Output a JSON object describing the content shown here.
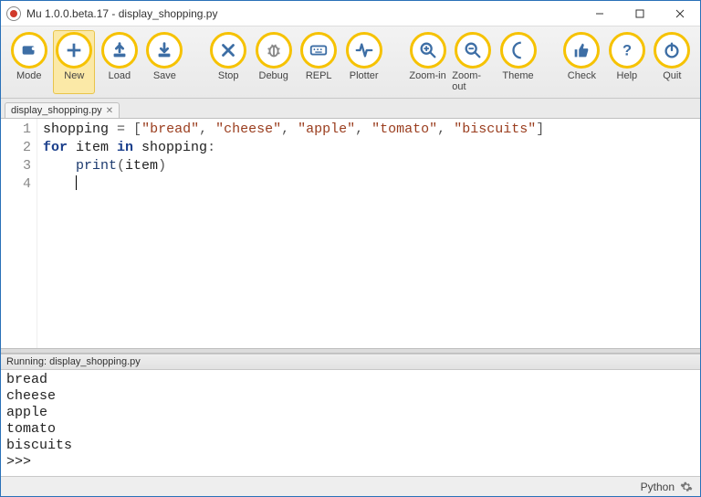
{
  "title": "Mu 1.0.0.beta.17 - display_shopping.py",
  "toolbar": [
    {
      "name": "mode",
      "label": "Mode",
      "icon": "mode",
      "selected": false
    },
    {
      "name": "new",
      "label": "New",
      "icon": "plus",
      "selected": true
    },
    {
      "name": "load",
      "label": "Load",
      "icon": "load",
      "selected": false
    },
    {
      "name": "save",
      "label": "Save",
      "icon": "save",
      "selected": false
    },
    {
      "spacer": true
    },
    {
      "name": "stop",
      "label": "Stop",
      "icon": "stop",
      "selected": false
    },
    {
      "name": "debug",
      "label": "Debug",
      "icon": "bug",
      "selected": false
    },
    {
      "name": "repl",
      "label": "REPL",
      "icon": "kbd",
      "selected": false
    },
    {
      "name": "plotter",
      "label": "Plotter",
      "icon": "pulse",
      "selected": false
    },
    {
      "spacer": true
    },
    {
      "name": "zoomin",
      "label": "Zoom-in",
      "icon": "zin",
      "selected": false
    },
    {
      "name": "zoomout",
      "label": "Zoom-out",
      "icon": "zout",
      "selected": false
    },
    {
      "name": "theme",
      "label": "Theme",
      "icon": "moon",
      "selected": false
    },
    {
      "spacer": true
    },
    {
      "name": "check",
      "label": "Check",
      "icon": "thumb",
      "selected": false
    },
    {
      "name": "help",
      "label": "Help",
      "icon": "help",
      "selected": false
    },
    {
      "name": "quit",
      "label": "Quit",
      "icon": "power",
      "selected": false
    }
  ],
  "tab": {
    "label": "display_shopping.py"
  },
  "editor": {
    "lineNumbers": [
      "1",
      "2",
      "3",
      "4"
    ],
    "tokens": [
      [
        {
          "t": "shopping ",
          "c": "nm"
        },
        {
          "t": "=",
          "c": "op"
        },
        {
          "t": " ",
          "c": "nm"
        },
        {
          "t": "[",
          "c": "op"
        },
        {
          "t": "\"bread\"",
          "c": "str"
        },
        {
          "t": ", ",
          "c": "op"
        },
        {
          "t": "\"cheese\"",
          "c": "str"
        },
        {
          "t": ", ",
          "c": "op"
        },
        {
          "t": "\"apple\"",
          "c": "str"
        },
        {
          "t": ", ",
          "c": "op"
        },
        {
          "t": "\"tomato\"",
          "c": "str"
        },
        {
          "t": ", ",
          "c": "op"
        },
        {
          "t": "\"biscuits\"",
          "c": "str"
        },
        {
          "t": "]",
          "c": "op"
        }
      ],
      [
        {
          "t": "for",
          "c": "kw"
        },
        {
          "t": " item ",
          "c": "nm"
        },
        {
          "t": "in",
          "c": "kw"
        },
        {
          "t": " shopping",
          "c": "nm"
        },
        {
          "t": ":",
          "c": "op"
        }
      ],
      [
        {
          "t": "    ",
          "c": "nm"
        },
        {
          "t": "print",
          "c": "fn"
        },
        {
          "t": "(",
          "c": "op"
        },
        {
          "t": "item",
          "c": "nm"
        },
        {
          "t": ")",
          "c": "op"
        }
      ],
      [
        {
          "t": "    ",
          "c": "nm"
        }
      ]
    ],
    "cursorLine": 3
  },
  "runner": {
    "header": "Running: display_shopping.py",
    "lines": [
      "bread",
      "cheese",
      "apple",
      "tomato",
      "biscuits",
      ">>>"
    ]
  },
  "status": {
    "mode": "Python"
  }
}
